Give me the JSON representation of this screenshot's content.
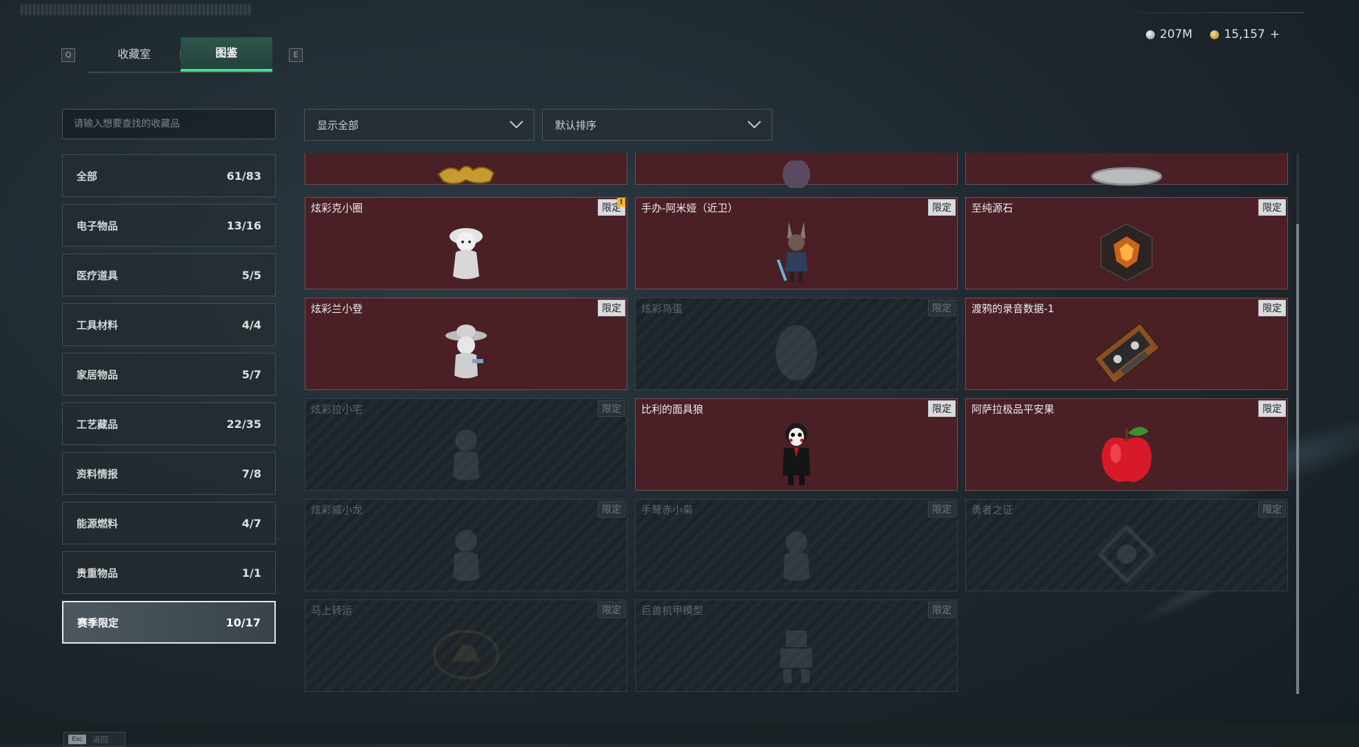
{
  "tabs": {
    "left_key": "Q",
    "right_key": "E",
    "items": [
      {
        "label": "收藏室",
        "active": false
      },
      {
        "label": "图鉴",
        "active": true
      }
    ]
  },
  "currency": {
    "silver": "207M",
    "gold": "15,157",
    "add_symbol": "+"
  },
  "search": {
    "placeholder": "请输入想要查找的收藏品"
  },
  "categories": [
    {
      "name": "全部",
      "count": "61/83"
    },
    {
      "name": "电子物品",
      "count": "13/16"
    },
    {
      "name": "医疗道具",
      "count": "5/5"
    },
    {
      "name": "工具材料",
      "count": "4/4"
    },
    {
      "name": "家居物品",
      "count": "5/7"
    },
    {
      "name": "工艺藏品",
      "count": "22/35"
    },
    {
      "name": "资料情报",
      "count": "7/8"
    },
    {
      "name": "能源燃料",
      "count": "4/7"
    },
    {
      "name": "贵重物品",
      "count": "1/1"
    },
    {
      "name": "赛季限定",
      "count": "10/17",
      "active": true
    }
  ],
  "filters": {
    "display": "显示全部",
    "sort": "默认排序"
  },
  "cards": [
    {
      "name": "",
      "badge": "",
      "owned": true,
      "icon": "golden-dragon-icon"
    },
    {
      "name": "",
      "badge": "",
      "owned": true,
      "icon": "egg-icon"
    },
    {
      "name": "",
      "badge": "",
      "owned": true,
      "icon": "silver-plate-icon"
    },
    {
      "name": "炫彩克小圈",
      "badge": "限定",
      "owned": true,
      "new": "!",
      "icon": "knight-figurine-icon"
    },
    {
      "name": "手办-阿米娅（近卫）",
      "badge": "限定",
      "owned": true,
      "icon": "amiya-figure-icon"
    },
    {
      "name": "至纯源石",
      "badge": "限定",
      "owned": true,
      "icon": "originium-crystal-icon"
    },
    {
      "name": "炫彩兰小登",
      "badge": "限定",
      "owned": true,
      "icon": "sombrero-figurine-icon"
    },
    {
      "name": "炫彩鸟蛋",
      "badge": "限定",
      "owned": false,
      "icon": "egg-icon"
    },
    {
      "name": "渡鸦的录音数据-1",
      "badge": "限定",
      "owned": true,
      "icon": "cassette-tape-icon"
    },
    {
      "name": "炫彩拉小宅",
      "badge": "限定",
      "owned": false,
      "icon": "figurine-icon"
    },
    {
      "name": "比利的面具狼",
      "badge": "限定",
      "owned": true,
      "icon": "billy-puppet-icon"
    },
    {
      "name": "阿萨拉极品平安果",
      "badge": "限定",
      "owned": true,
      "icon": "red-apple-icon"
    },
    {
      "name": "炫彩威小龙",
      "badge": "限定",
      "owned": false,
      "icon": "figurine-icon"
    },
    {
      "name": "手弩赤小枭",
      "badge": "限定",
      "owned": false,
      "icon": "owl-figure-icon"
    },
    {
      "name": "勇者之证",
      "badge": "限定",
      "owned": false,
      "icon": "badge-emblem-icon"
    },
    {
      "name": "马上转运",
      "badge": "限定",
      "owned": false,
      "icon": "golden-horse-icon"
    },
    {
      "name": "巨兽机甲模型",
      "badge": "限定",
      "owned": false,
      "icon": "mech-model-icon"
    }
  ],
  "bottom": {
    "back_key": "Esc",
    "back_label": "返回"
  }
}
